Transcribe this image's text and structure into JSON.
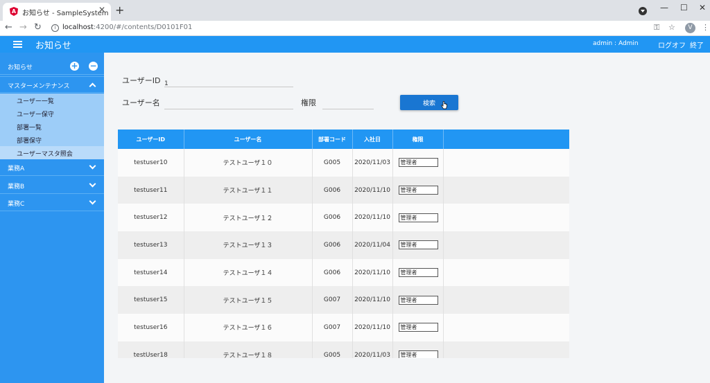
{
  "browser": {
    "tab_title": "お知らせ - SampleSystem",
    "url_host": "localhost",
    "url_path": ":4200/#/contents/D0101F01",
    "profile_initial": "V"
  },
  "header": {
    "title": "お知らせ",
    "user": "admin : Admin",
    "logoff": "ログオフ",
    "exit": "終了"
  },
  "sidebar": {
    "notice": "お知らせ",
    "master": "マスターメンテナンス",
    "sub_items": [
      "ユーザー一覧",
      "ユーザー保守",
      "部署一覧",
      "部署保守",
      "ユーザーマスタ照会"
    ],
    "groups": [
      "業務A",
      "業務B",
      "業務C"
    ]
  },
  "search": {
    "user_id_label": "ユーザーID",
    "user_id_value": "1",
    "user_name_label": "ユーザー名",
    "user_name_value": "",
    "permission_label": "権限",
    "permission_value": "",
    "button": "検索"
  },
  "table": {
    "headers": [
      "ユーザーID",
      "ユーザー名",
      "部署コード",
      "入社日",
      "権限"
    ],
    "rows": [
      {
        "id": "testuser10",
        "name": "テストユーザ１０",
        "dept": "G005",
        "date": "2020/11/03",
        "perm": "管理者"
      },
      {
        "id": "testuser11",
        "name": "テストユーザ１１",
        "dept": "G006",
        "date": "2020/11/10",
        "perm": "管理者"
      },
      {
        "id": "testuser12",
        "name": "テストユーザ１２",
        "dept": "G006",
        "date": "2020/11/10",
        "perm": "管理者"
      },
      {
        "id": "testuser13",
        "name": "テストユーザ１３",
        "dept": "G006",
        "date": "2020/11/04",
        "perm": "管理者"
      },
      {
        "id": "testuser14",
        "name": "テストユーザ１４",
        "dept": "G006",
        "date": "2020/11/10",
        "perm": "管理者"
      },
      {
        "id": "testuser15",
        "name": "テストユーザ１５",
        "dept": "G007",
        "date": "2020/11/10",
        "perm": "管理者"
      },
      {
        "id": "testuser16",
        "name": "テストユーザ１６",
        "dept": "G007",
        "date": "2020/11/10",
        "perm": "管理者"
      },
      {
        "id": "testUser18",
        "name": "テストユーザ１８",
        "dept": "G005",
        "date": "2020/11/03",
        "perm": "管理者"
      }
    ]
  },
  "colors": {
    "primary": "#2196f3",
    "button": "#1976d2",
    "sidebar_sub": "#9dcdf8"
  }
}
